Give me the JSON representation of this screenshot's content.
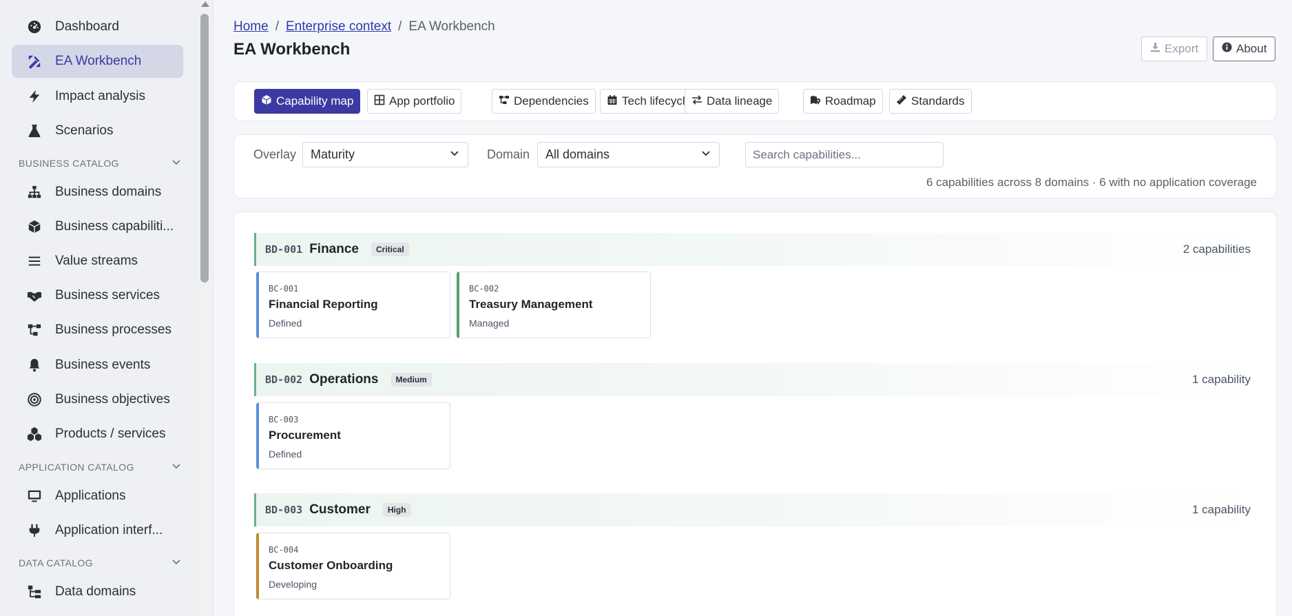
{
  "sidebar": {
    "items": [
      {
        "label": "Dashboard",
        "icon": "dashboard-icon"
      },
      {
        "label": "EA Workbench",
        "icon": "workbench-icon"
      },
      {
        "label": "Impact analysis",
        "icon": "lightning-icon"
      },
      {
        "label": "Scenarios",
        "icon": "flask-icon"
      },
      {
        "label": "Business domains",
        "icon": "sitemap-icon"
      },
      {
        "label": "Business capabiliti...",
        "icon": "cube-icon"
      },
      {
        "label": "Value streams",
        "icon": "lines-icon"
      },
      {
        "label": "Business services",
        "icon": "handshake-icon"
      },
      {
        "label": "Business processes",
        "icon": "process-icon"
      },
      {
        "label": "Business events",
        "icon": "bell-icon"
      },
      {
        "label": "Business objectives",
        "icon": "target-icon"
      },
      {
        "label": "Products / services",
        "icon": "cubes-icon"
      },
      {
        "label": "Applications",
        "icon": "monitor-icon"
      },
      {
        "label": "Application interf...",
        "icon": "plug-icon"
      },
      {
        "label": "Data domains",
        "icon": "data-tree-icon"
      }
    ],
    "sections": {
      "business": "BUSINESS CATALOG",
      "application": "APPLICATION CATALOG",
      "data": "DATA CATALOG"
    }
  },
  "header": {
    "breadcrumb": {
      "home": "Home",
      "sep1": "/",
      "context": "Enterprise context",
      "sep2": "/",
      "current": "EA Workbench"
    },
    "title": "EA Workbench",
    "export_label": "Export",
    "about_label": "About"
  },
  "tabs": [
    {
      "label": "Capability map"
    },
    {
      "label": "App portfolio"
    },
    {
      "label": "Dependencies"
    },
    {
      "label": "Tech lifecycle"
    },
    {
      "label": "Data lineage"
    },
    {
      "label": "Roadmap"
    },
    {
      "label": "Standards"
    }
  ],
  "filters": {
    "overlay_label": "Overlay",
    "overlay_value": "Maturity",
    "domain_label": "Domain",
    "domain_value": "All domains",
    "search_placeholder": "Search capabilities...",
    "summary": "6 capabilities across 8 domains · 6 with no application coverage"
  },
  "domains": [
    {
      "code": "BD-001",
      "name": "Finance",
      "badge": "Critical",
      "count": "2 capabilities",
      "caps": [
        {
          "code": "BC-001",
          "name": "Financial Reporting",
          "maturity": "Defined",
          "color": "#5b8fd6"
        },
        {
          "code": "BC-002",
          "name": "Treasury Management",
          "maturity": "Managed",
          "color": "#4fa36e"
        }
      ]
    },
    {
      "code": "BD-002",
      "name": "Operations",
      "badge": "Medium",
      "count": "1 capability",
      "caps": [
        {
          "code": "BC-003",
          "name": "Procurement",
          "maturity": "Defined",
          "color": "#5b8fd6"
        }
      ]
    },
    {
      "code": "BD-003",
      "name": "Customer",
      "badge": "High",
      "count": "1 capability",
      "caps": [
        {
          "code": "BC-004",
          "name": "Customer Onboarding",
          "maturity": "Developing",
          "color": "#c08a2e"
        }
      ]
    }
  ],
  "colors": {
    "accent": "#3b3aa3",
    "domain_border": "#6ab088"
  }
}
